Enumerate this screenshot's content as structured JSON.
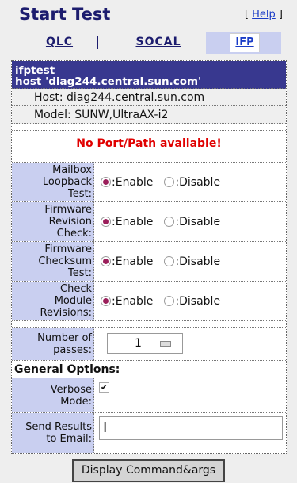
{
  "header": {
    "title": "Start Test",
    "help_open": "[",
    "help_label": "Help",
    "help_close": "]"
  },
  "tabs": [
    {
      "label": "QLC",
      "active": false
    },
    {
      "label": "SOCAL",
      "active": false
    },
    {
      "label": "IFP",
      "active": true
    }
  ],
  "device": {
    "title_line1": "ifptest",
    "title_line2": "host 'diag244.central.sun.com'",
    "host": "Host: diag244.central.sun.com",
    "model": "Model: SUNW,UltraAX-i2",
    "error": "No Port/Path available!"
  },
  "options": [
    {
      "label_lines": [
        "Mailbox",
        "Loopback",
        "Test:"
      ],
      "enable": ":Enable",
      "disable": ":Disable",
      "selected": "enable"
    },
    {
      "label_lines": [
        "Firmware",
        "Revision",
        "Check:"
      ],
      "enable": ":Enable",
      "disable": ":Disable",
      "selected": "enable"
    },
    {
      "label_lines": [
        "Firmware",
        "Checksum",
        "Test:"
      ],
      "enable": ":Enable",
      "disable": ":Disable",
      "selected": "enable"
    },
    {
      "label_lines": [
        "Check",
        "Module",
        "Revisions:"
      ],
      "enable": ":Enable",
      "disable": ":Disable",
      "selected": "enable"
    }
  ],
  "passes": {
    "label_lines": [
      "Number of",
      "passes:"
    ],
    "value": "1"
  },
  "general": {
    "heading": "General Options:",
    "verbose_lines": [
      "Verbose",
      "Mode:"
    ],
    "verbose_checked": true,
    "check_glyph": "✔",
    "email_lines": [
      "Send Results",
      "to Email:"
    ],
    "email_value": "I"
  },
  "footer": {
    "button_label": "Display Command&args"
  },
  "colors": {
    "title": "#1c1c6e",
    "banner": "#38388f",
    "label_bg": "#c9cff0",
    "error": "#e00000",
    "radio": "#9b1f5b"
  }
}
